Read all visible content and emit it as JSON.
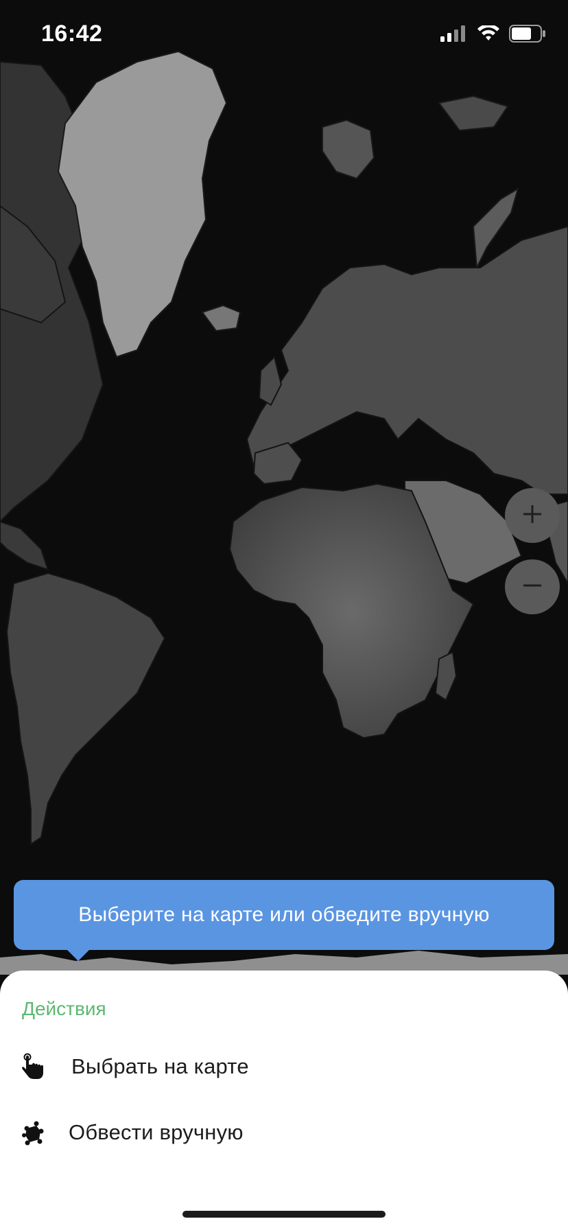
{
  "status_bar": {
    "time": "16:42",
    "signal_icon": "cellular-signal-icon",
    "wifi_icon": "wifi-icon",
    "battery_icon": "battery-icon"
  },
  "map": {
    "style": "dark world map",
    "zoom_in_icon": "plus-icon",
    "zoom_out_icon": "minus-icon"
  },
  "tooltip": {
    "text": "Выберите на карте или обведите вручную",
    "color": "#5a95e2"
  },
  "sheet": {
    "header": "Действия",
    "header_color": "#5cb871",
    "actions": [
      {
        "label": "Выбрать на карте",
        "icon": "hand-pointer-icon"
      },
      {
        "label": "Обвести вручную",
        "icon": "lasso-draw-icon"
      }
    ]
  }
}
